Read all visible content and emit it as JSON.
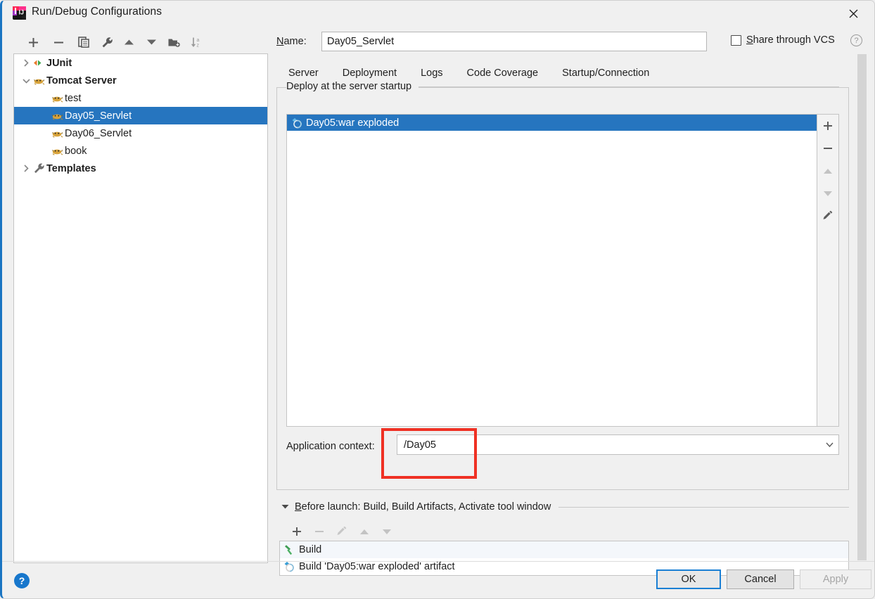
{
  "window": {
    "title": "Run/Debug Configurations",
    "app_icon": "intellij-idea-icon",
    "close_label": "✕"
  },
  "left_toolbar": {
    "buttons": [
      {
        "name": "add-configuration-button",
        "icon": "plus-icon",
        "label": "+"
      },
      {
        "name": "remove-configuration-button",
        "icon": "minus-icon",
        "label": "−"
      },
      {
        "name": "copy-configuration-button",
        "icon": "copy-icon",
        "label": "⧉"
      },
      {
        "name": "edit-templates-button",
        "icon": "wrench-icon",
        "label": "🔧"
      },
      {
        "name": "move-up-button",
        "icon": "arrow-up-icon",
        "label": "▲"
      },
      {
        "name": "move-down-button",
        "icon": "arrow-down-icon",
        "label": "▼"
      },
      {
        "name": "move-into-folder-button",
        "icon": "new-folder-icon",
        "label": "🗀"
      },
      {
        "name": "sort-configurations-button",
        "icon": "sort-alpha-icon",
        "label": "↓az"
      }
    ]
  },
  "tree": {
    "items": [
      {
        "label": "JUnit",
        "icon": "junit-icon",
        "arrow": "›",
        "expanded": false,
        "level": 0,
        "bold": true,
        "selected": false
      },
      {
        "label": "Tomcat Server",
        "icon": "tomcat-icon",
        "arrow": "⌄",
        "expanded": true,
        "level": 0,
        "bold": true,
        "selected": false
      },
      {
        "label": "test",
        "icon": "tomcat-icon",
        "arrow": "",
        "level": 1,
        "bold": false,
        "selected": false
      },
      {
        "label": "Day05_Servlet",
        "icon": "tomcat-icon",
        "arrow": "",
        "level": 1,
        "bold": false,
        "selected": true
      },
      {
        "label": "Day06_Servlet",
        "icon": "tomcat-icon",
        "arrow": "",
        "level": 1,
        "bold": false,
        "selected": false
      },
      {
        "label": "book",
        "icon": "tomcat-icon",
        "arrow": "",
        "level": 1,
        "bold": false,
        "selected": false
      },
      {
        "label": "Templates",
        "icon": "wrench-icon",
        "arrow": "›",
        "expanded": false,
        "level": 0,
        "bold": true,
        "selected": false
      }
    ]
  },
  "name_row": {
    "label": "Name:",
    "label_mnemonic": "N",
    "label_rest": "ame:",
    "value": "Day05_Servlet",
    "placeholder": "Name",
    "share_label": "Share through VCS",
    "share_mnemonic": "S",
    "share_rest": "hare through VCS",
    "share_checked": false,
    "help_label": "?"
  },
  "tabs": [
    {
      "label": "Server",
      "active": false
    },
    {
      "label": "Deployment",
      "active": true
    },
    {
      "label": "Logs",
      "active": false
    },
    {
      "label": "Code Coverage",
      "active": false
    },
    {
      "label": "Startup/Connection",
      "active": false
    }
  ],
  "deployment": {
    "legend": "Deploy at the server startup",
    "artifact_icon": "artifact-icon",
    "artifact_label": "Day05:war exploded",
    "side_buttons": [
      {
        "name": "add-artifact-button",
        "icon": "plus-icon",
        "label": "+",
        "enabled": true
      },
      {
        "name": "remove-artifact-button",
        "icon": "minus-icon",
        "label": "−",
        "enabled": true
      },
      {
        "name": "move-artifact-up-button",
        "icon": "arrow-up-icon",
        "label": "▲",
        "enabled": false
      },
      {
        "name": "move-artifact-down-button",
        "icon": "arrow-down-icon",
        "label": "▼",
        "enabled": false
      },
      {
        "name": "edit-artifact-button",
        "icon": "pencil-icon",
        "label": "✎",
        "enabled": true
      }
    ],
    "app_context_label": "Application context:",
    "app_context_value": "/Day05",
    "app_context_arrow": "⌄",
    "highlight_color": "#ef3124"
  },
  "before_launch": {
    "triangle": "▾",
    "title": "Before launch: Build, Build Artifacts, Activate tool window",
    "title_mnemonic": "B",
    "title_rest": "efore launch: Build, Build Artifacts, Activate tool window",
    "toolbar": [
      {
        "name": "add-task-button",
        "icon": "plus-icon",
        "label": "+",
        "enabled": true
      },
      {
        "name": "remove-task-button",
        "icon": "minus-icon",
        "label": "−",
        "enabled": false
      },
      {
        "name": "edit-task-button",
        "icon": "pencil-icon",
        "label": "✎",
        "enabled": false
      },
      {
        "name": "task-up-button",
        "icon": "arrow-up-icon",
        "label": "▲",
        "enabled": false
      },
      {
        "name": "task-down-button",
        "icon": "arrow-down-icon",
        "label": "▼",
        "enabled": false
      }
    ],
    "tasks": [
      {
        "label": "Build",
        "icon": "hammer-icon"
      },
      {
        "label": "Build 'Day05:war exploded' artifact",
        "icon": "artifact-icon"
      }
    ]
  },
  "footer": {
    "help_label": "?",
    "ok_label": "OK",
    "cancel_label": "Cancel",
    "apply_label": "Apply",
    "apply_enabled": false
  },
  "colors": {
    "accent": "#2675bf",
    "tab_underline": "#2c74b3",
    "highlight": "#ef3124",
    "window_edge": "#1a75c2"
  }
}
